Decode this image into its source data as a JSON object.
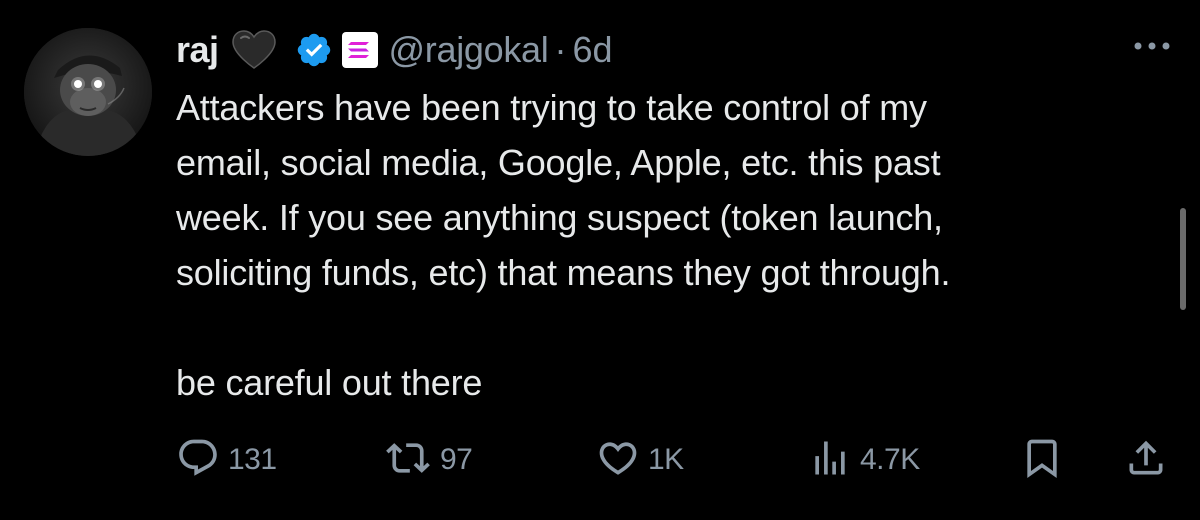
{
  "tweet": {
    "display_name": "raj",
    "name_emoji": "black-heart-icon",
    "verified": true,
    "affiliate_badge": "solana-logo-icon",
    "handle": "@rajgokal",
    "separator": "·",
    "time": "6d",
    "body_lines": [
      "Attackers have been trying to take control of my",
      "email, social media, Google, Apple, etc. this past",
      "week. If you see anything suspect (token launch,",
      "soliciting funds, etc) that means they got through."
    ],
    "body_line_last": "be careful out there"
  },
  "actions": {
    "replies": "131",
    "reposts": "97",
    "likes": "1K",
    "views": "4.7K"
  },
  "colors": {
    "background": "#000000",
    "text": "#e7e9ea",
    "secondary": "#8b98a5",
    "verified_blue": "#1d9bf0"
  }
}
